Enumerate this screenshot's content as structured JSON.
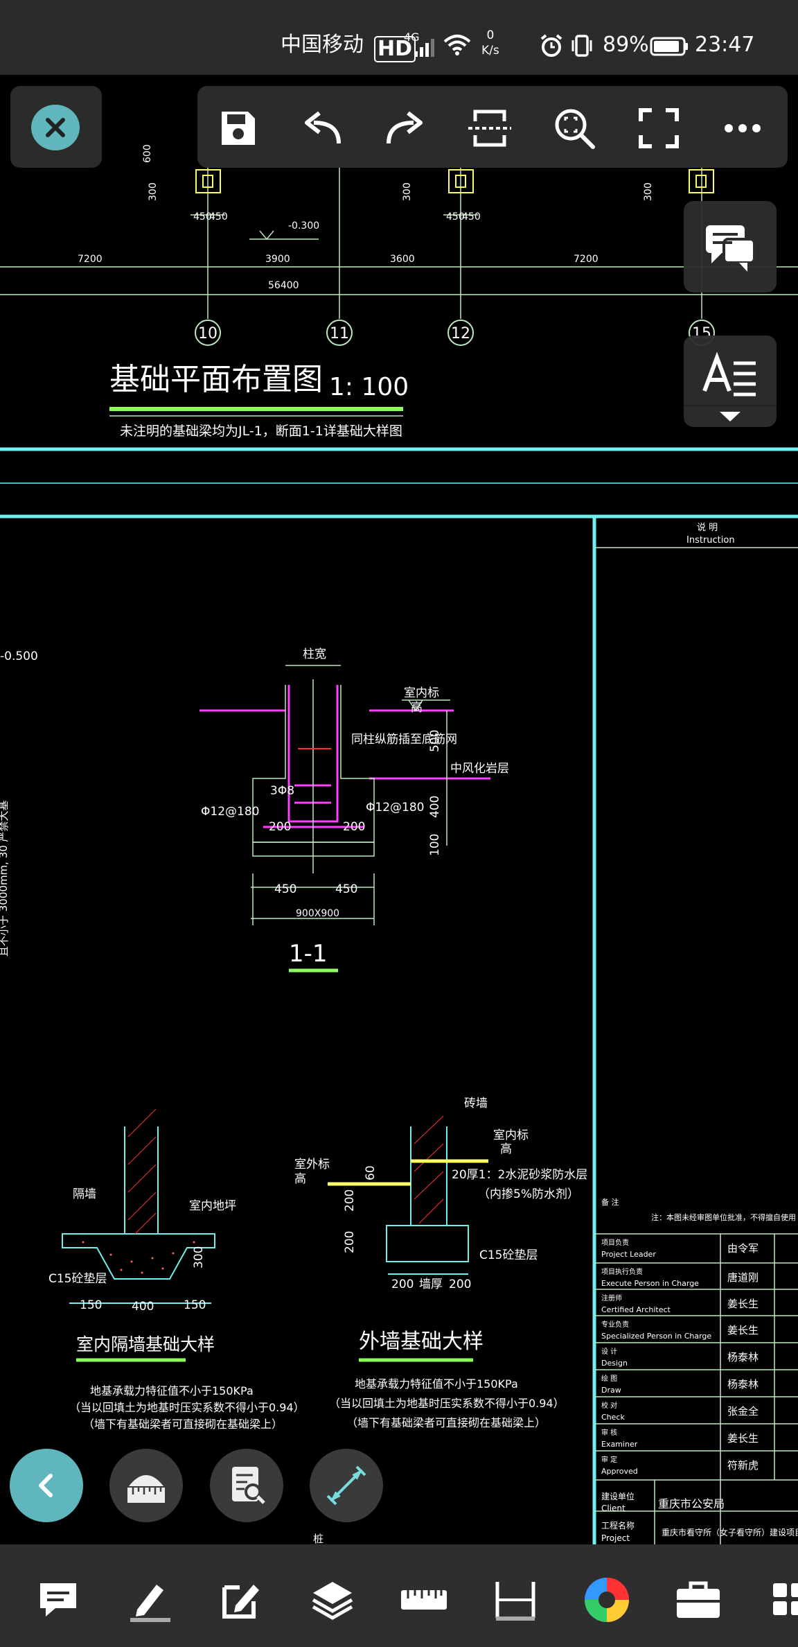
{
  "status_bar": {
    "carrier": "中国移动",
    "hd_badge": "HD",
    "network": "4G",
    "net_speed_value": "0",
    "net_speed_unit": "K/s",
    "battery_percent": "89%",
    "time": "23:47"
  },
  "toolbar": {
    "buttons": [
      "save",
      "undo",
      "redo",
      "section",
      "zoom-window",
      "fullscreen",
      "more"
    ]
  },
  "side_buttons": [
    "comments",
    "text-style"
  ],
  "drawing": {
    "plan_title": "基础平面布置图",
    "plan_scale": "1: 100",
    "plan_note": "未注明的基础梁均为JL-1，断面1-1详基础大样图",
    "dims_top": [
      "600",
      "300",
      "450",
      "450",
      "300",
      "450",
      "450",
      "300"
    ],
    "level_mark": "-0.300",
    "span_labels": [
      "7200",
      "3900",
      "3600",
      "7200"
    ],
    "total_span": "56400",
    "axis_labels": [
      "10",
      "11",
      "12",
      "15"
    ],
    "section": {
      "left_level": "-0.500",
      "col_width": "柱宽",
      "indoor_level": "室内标高",
      "rebar_note": "同柱纵筋插至底筋网",
      "rock": "中风化岩层",
      "stirrup": "3Φ8",
      "rebar_left": "Φ12@180",
      "rebar_right": "Φ12@180",
      "dim_200_left": "200",
      "dim_200_right": "200",
      "dim_500": "500",
      "dim_400": "400",
      "dim_100": "100",
      "half_left": "450",
      "half_right": "450",
      "footing": "900X900",
      "section_label": "1-1",
      "side_note": "且不小于 3000mm, 30 严禁大基"
    },
    "detail_inner": {
      "partition": "隔墙",
      "floor": "室内地坪",
      "concrete": "C15砼垫层",
      "dim_300": "300",
      "dims": [
        "150",
        "400",
        "150"
      ],
      "title": "室内隔墙基础大样",
      "notes": [
        "地基承载力特征值不小于150KPa",
        "（当以回填土为地基时压实系数不得小于0.94）",
        "（墙下有基础梁者可直接砌在基础梁上）"
      ]
    },
    "detail_outer": {
      "brick": "砖墙",
      "indoor": "室内标高",
      "outdoor": "室外标高",
      "damp_proof": "20厚1：2水泥砂浆防水层",
      "damp_proof_sub": "（内掺5%防水剂）",
      "dim_60": "60",
      "dim_200a": "200",
      "dim_200b": "200",
      "concrete": "C15砼垫层",
      "dims": [
        "200",
        "墙厚",
        "200"
      ],
      "title": "外墙基础大样",
      "notes": [
        "地基承载力特征值不小于150KPa",
        "（当以回填土为地基时压实系数不得小于0.94）",
        "（墙下有基础梁者可直接砌在基础梁上）"
      ]
    },
    "bottom_mark": "桩",
    "title_block": {
      "header_cn": "说 明",
      "header_en": "Instruction",
      "remark_label": "备 注",
      "remark_text": "注：本图未经审图单位批准，不得擅自使用",
      "rows": [
        {
          "cn": "项目负责",
          "en": "Project Leader",
          "name": "由令军"
        },
        {
          "cn": "项目执行负责",
          "en": "Execute Person in Charge",
          "name": "唐道刚"
        },
        {
          "cn": "注册师",
          "en": "Certified Architect",
          "name": "姜长生"
        },
        {
          "cn": "专业负责",
          "en": "Specialized Person in Charge",
          "name": "姜长生"
        },
        {
          "cn": "设 计",
          "en": "Design",
          "name": "杨泰林"
        },
        {
          "cn": "绘 图",
          "en": "Draw",
          "name": "杨泰林"
        },
        {
          "cn": "校 对",
          "en": "Check",
          "name": "张金全"
        },
        {
          "cn": "审 核",
          "en": "Examiner",
          "name": "姜长生"
        },
        {
          "cn": "审 定",
          "en": "Approved",
          "name": "符新虎"
        }
      ],
      "client_cn": "建设单位",
      "client_en": "Client",
      "client_value": "重庆市公安局",
      "project_cn": "工程名称",
      "project_en": "Project",
      "project_value": "重庆市看守所（女子看守所）建设项目"
    }
  },
  "fab_buttons": [
    "back",
    "measure-area",
    "find-text",
    "measure-length"
  ],
  "bottom_tools": [
    "comment",
    "draw",
    "edit",
    "layers",
    "ruler",
    "dimension",
    "color",
    "toolbox",
    "grid"
  ],
  "colors": {
    "accent": "#5fb7bd",
    "cad_line": "#aaddaa",
    "cad_text": "#ffffff",
    "cad_cyan": "#6ef0f0",
    "cad_magenta": "#ff40ff",
    "cad_green": "#8cff5a",
    "cad_red": "#ff3030"
  }
}
